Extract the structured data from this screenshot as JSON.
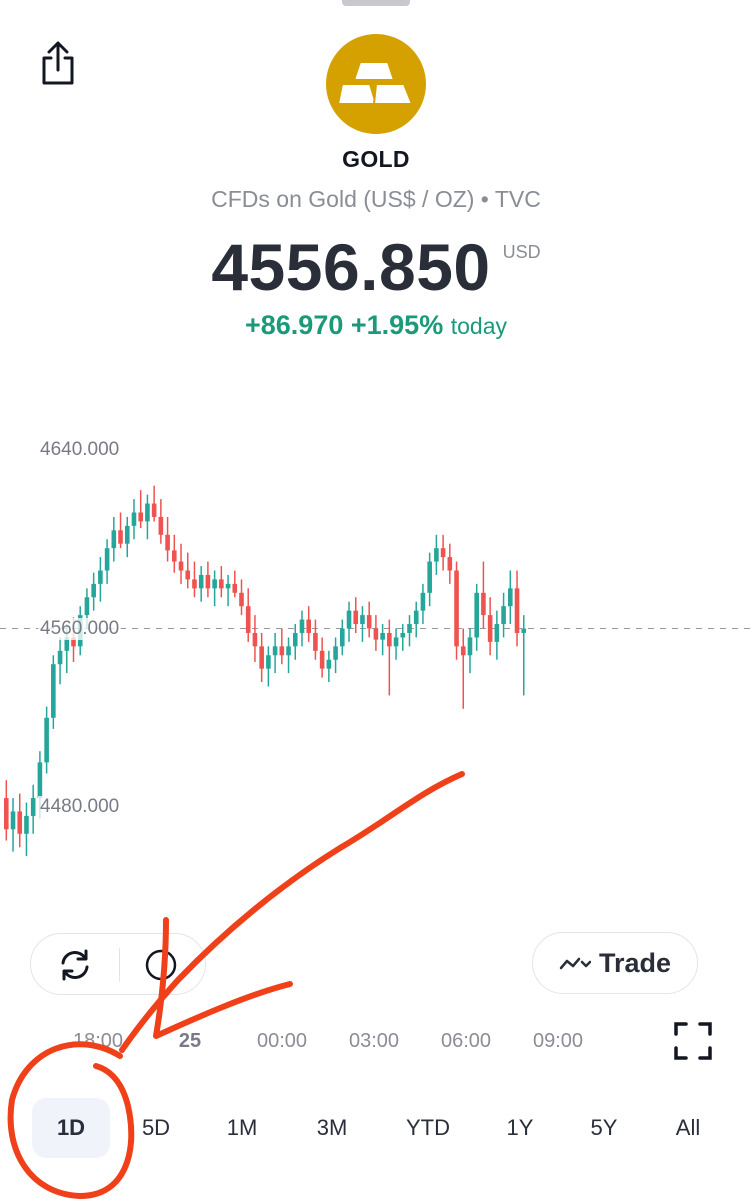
{
  "header": {
    "symbol": "GOLD",
    "description": "CFDs on Gold (US$ / OZ) • TVC",
    "price": "4556.850",
    "currency": "USD",
    "change_abs": "+86.970",
    "change_pct": "+1.95%",
    "change_suffix": "today",
    "change_color": "#1a9a78"
  },
  "icons": {
    "share": "share-icon",
    "logo": "gold-bars-icon",
    "reload": "reload-icon",
    "clock": "clock-icon",
    "trade": "trend-chart-icon",
    "fullscreen": "fullscreen-icon"
  },
  "colors": {
    "up": "#26a69a",
    "down": "#ef5350",
    "brand_gold": "#d4a100",
    "annotation": "#f0401a"
  },
  "chart_data": {
    "type": "candlestick",
    "y_ticks": [
      "4640.000",
      "4560.000",
      "4480.000"
    ],
    "x_ticks": [
      "18:00",
      "25",
      "00:00",
      "03:00",
      "06:00",
      "09:00"
    ],
    "ylim": [
      4450,
      4660
    ],
    "reference_line": 4560,
    "candles": [
      [
        4484,
        4492,
        4465,
        4470
      ],
      [
        4470,
        4484,
        4460,
        4478
      ],
      [
        4478,
        4486,
        4462,
        4468
      ],
      [
        4468,
        4482,
        4458,
        4476
      ],
      [
        4476,
        4490,
        4468,
        4484
      ],
      [
        4484,
        4505,
        4475,
        4500
      ],
      [
        4500,
        4525,
        4495,
        4520
      ],
      [
        4520,
        4548,
        4515,
        4544
      ],
      [
        4544,
        4556,
        4535,
        4550
      ],
      [
        4550,
        4562,
        4540,
        4556
      ],
      [
        4556,
        4565,
        4545,
        4552
      ],
      [
        4552,
        4570,
        4548,
        4566
      ],
      [
        4566,
        4578,
        4560,
        4574
      ],
      [
        4574,
        4585,
        4568,
        4580
      ],
      [
        4580,
        4592,
        4572,
        4586
      ],
      [
        4586,
        4600,
        4580,
        4596
      ],
      [
        4596,
        4610,
        4590,
        4604
      ],
      [
        4604,
        4612,
        4596,
        4598
      ],
      [
        4598,
        4610,
        4592,
        4606
      ],
      [
        4606,
        4618,
        4600,
        4612
      ],
      [
        4612,
        4622,
        4605,
        4608
      ],
      [
        4608,
        4620,
        4600,
        4616
      ],
      [
        4616,
        4624,
        4608,
        4610
      ],
      [
        4610,
        4618,
        4598,
        4602
      ],
      [
        4602,
        4610,
        4590,
        4595
      ],
      [
        4595,
        4602,
        4585,
        4590
      ],
      [
        4590,
        4598,
        4580,
        4586
      ],
      [
        4586,
        4594,
        4578,
        4582
      ],
      [
        4582,
        4590,
        4574,
        4578
      ],
      [
        4578,
        4588,
        4572,
        4584
      ],
      [
        4584,
        4590,
        4574,
        4578
      ],
      [
        4578,
        4586,
        4570,
        4582
      ],
      [
        4582,
        4588,
        4574,
        4578
      ],
      [
        4578,
        4584,
        4570,
        4580
      ],
      [
        4580,
        4586,
        4574,
        4576
      ],
      [
        4576,
        4582,
        4566,
        4570
      ],
      [
        4570,
        4578,
        4554,
        4558
      ],
      [
        4558,
        4566,
        4545,
        4552
      ],
      [
        4552,
        4558,
        4536,
        4542
      ],
      [
        4542,
        4552,
        4534,
        4548
      ],
      [
        4548,
        4558,
        4540,
        4552
      ],
      [
        4552,
        4560,
        4544,
        4548
      ],
      [
        4548,
        4556,
        4540,
        4552
      ],
      [
        4552,
        4562,
        4546,
        4558
      ],
      [
        4558,
        4568,
        4552,
        4564
      ],
      [
        4564,
        4570,
        4554,
        4558
      ],
      [
        4558,
        4564,
        4546,
        4550
      ],
      [
        4550,
        4556,
        4538,
        4542
      ],
      [
        4542,
        4550,
        4536,
        4546
      ],
      [
        4546,
        4556,
        4540,
        4552
      ],
      [
        4552,
        4564,
        4548,
        4560
      ],
      [
        4560,
        4572,
        4554,
        4568
      ],
      [
        4568,
        4574,
        4558,
        4562
      ],
      [
        4562,
        4570,
        4554,
        4566
      ],
      [
        4566,
        4572,
        4556,
        4560
      ],
      [
        4560,
        4566,
        4550,
        4555
      ],
      [
        4555,
        4562,
        4548,
        4558
      ],
      [
        4558,
        4564,
        4530,
        4552
      ],
      [
        4552,
        4560,
        4546,
        4556
      ],
      [
        4556,
        4562,
        4550,
        4558
      ],
      [
        4558,
        4566,
        4552,
        4562
      ],
      [
        4562,
        4572,
        4556,
        4568
      ],
      [
        4568,
        4580,
        4562,
        4576
      ],
      [
        4576,
        4594,
        4570,
        4590
      ],
      [
        4590,
        4602,
        4584,
        4596
      ],
      [
        4596,
        4602,
        4586,
        4592
      ],
      [
        4592,
        4598,
        4580,
        4586
      ],
      [
        4586,
        4590,
        4546,
        4552
      ],
      [
        4552,
        4560,
        4524,
        4548
      ],
      [
        4548,
        4560,
        4540,
        4556
      ],
      [
        4556,
        4580,
        4550,
        4576
      ],
      [
        4576,
        4590,
        4560,
        4566
      ],
      [
        4566,
        4574,
        4548,
        4554
      ],
      [
        4554,
        4568,
        4546,
        4562
      ],
      [
        4562,
        4576,
        4556,
        4570
      ],
      [
        4570,
        4586,
        4562,
        4578
      ],
      [
        4578,
        4586,
        4552,
        4558
      ],
      [
        4558,
        4566,
        4530,
        4560
      ]
    ]
  },
  "controls": {
    "trade_label": "Trade"
  },
  "ranges": [
    {
      "label": "1D",
      "active": true
    },
    {
      "label": "5D",
      "active": false
    },
    {
      "label": "1M",
      "active": false
    },
    {
      "label": "3M",
      "active": false
    },
    {
      "label": "YTD",
      "active": false
    },
    {
      "label": "1Y",
      "active": false
    },
    {
      "label": "5Y",
      "active": false
    },
    {
      "label": "All",
      "active": false
    }
  ]
}
